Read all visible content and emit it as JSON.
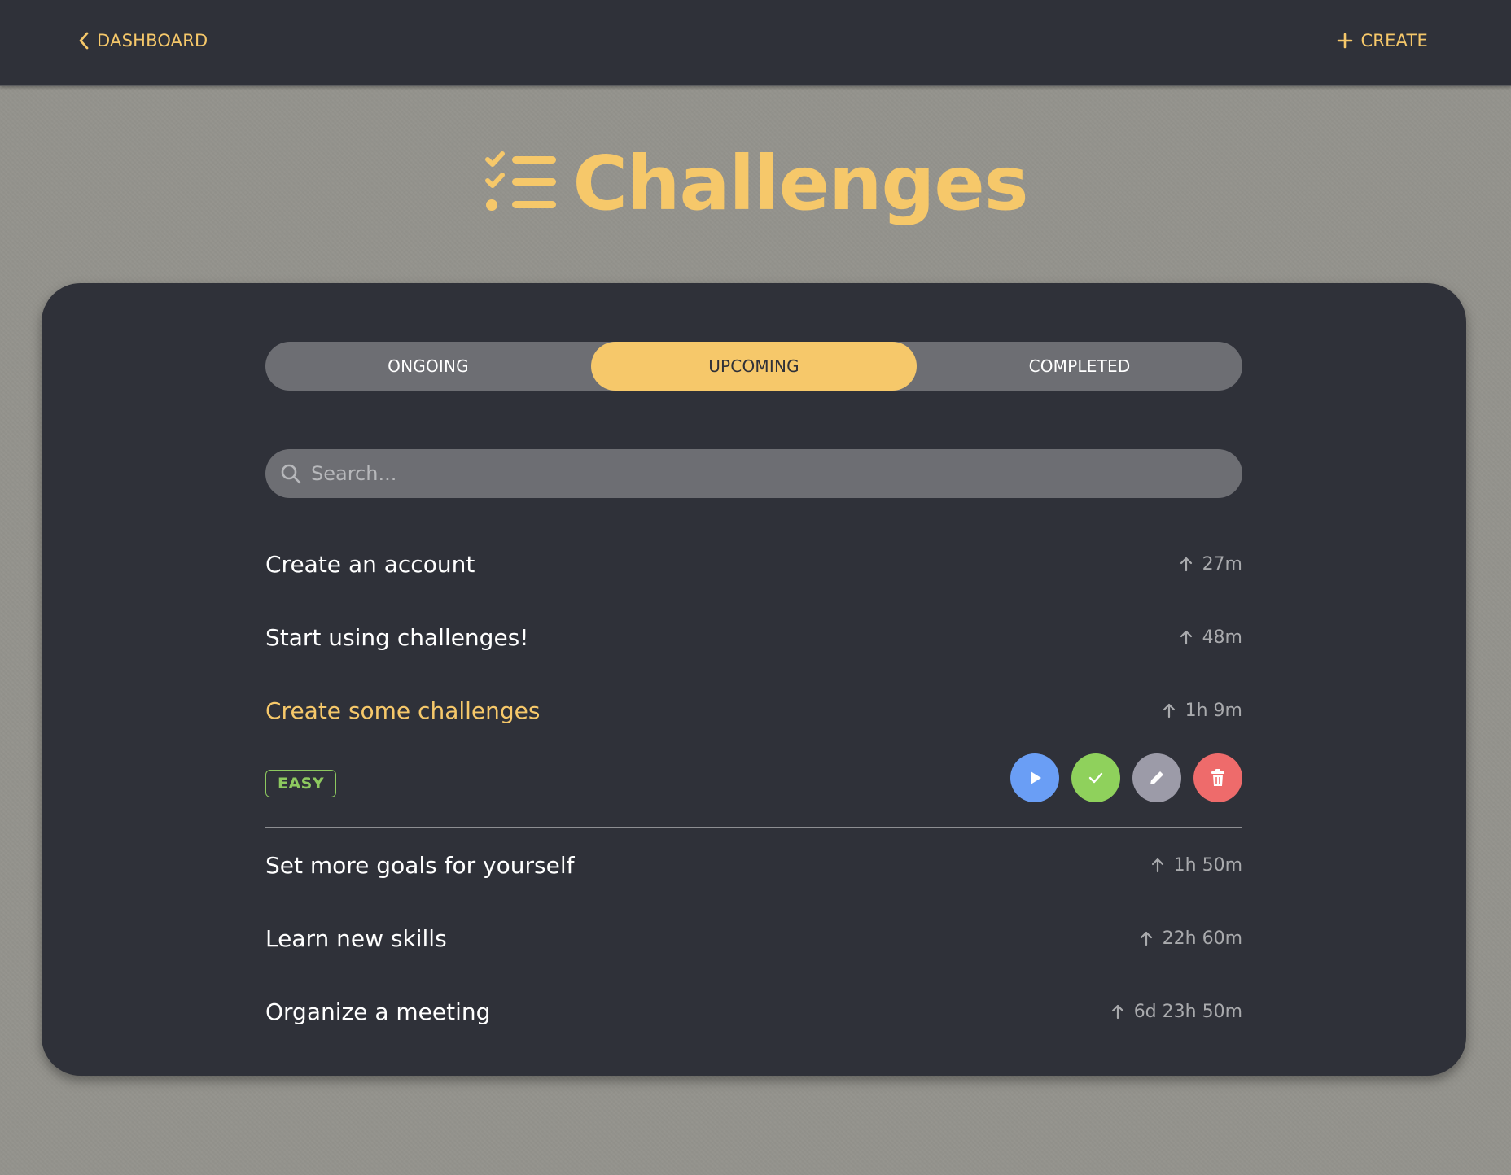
{
  "nav": {
    "back_label": "DASHBOARD",
    "create_label": "CREATE",
    "back_icon": "chevron-left-icon",
    "create_icon": "plus-icon"
  },
  "page": {
    "title": "Challenges",
    "title_icon": "checklist-icon"
  },
  "tabs": [
    {
      "label": "ONGOING",
      "active": false
    },
    {
      "label": "UPCOMING",
      "active": true
    },
    {
      "label": "COMPLETED",
      "active": false
    }
  ],
  "search": {
    "placeholder": "Search...",
    "value": ""
  },
  "challenges": [
    {
      "title": "Create an account",
      "time": "27m"
    },
    {
      "title": "Start using challenges!",
      "time": "48m"
    },
    {
      "title": "Create some challenges",
      "time": "1h 9m",
      "selected": true,
      "difficulty": "EASY"
    },
    {
      "title": "Set more goals for yourself",
      "time": "1h 50m"
    },
    {
      "title": "Learn new skills",
      "time": "22h 60m"
    },
    {
      "title": "Organize a meeting",
      "time": "6d 23h 50m"
    }
  ],
  "colors": {
    "accent": "#f6c86a",
    "panel": "#2f3139",
    "play": "#6a9ef5",
    "complete": "#8fd15c",
    "edit": "#9c9ba8",
    "delete": "#ee6b6b",
    "easy": "#8dc85f"
  },
  "action_icons": [
    "play-icon",
    "check-icon",
    "pencil-icon",
    "trash-icon"
  ]
}
